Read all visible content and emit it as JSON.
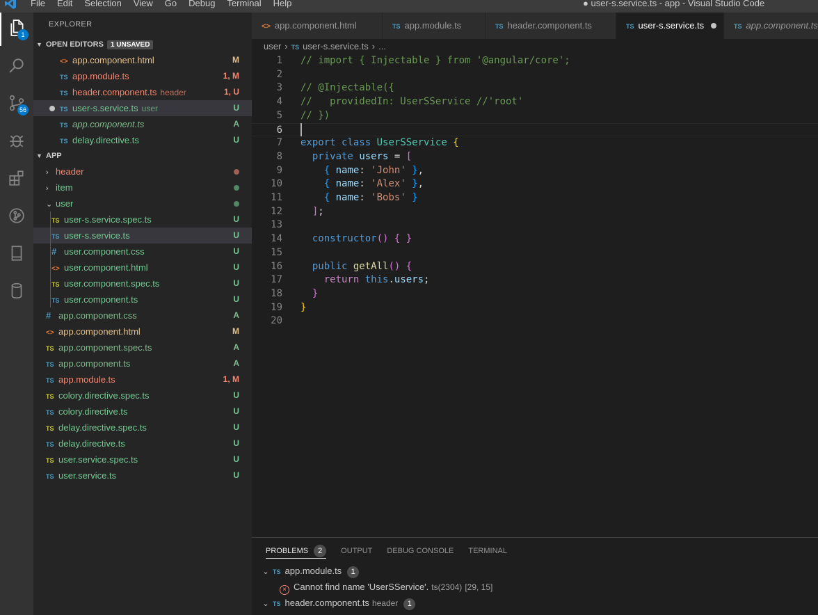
{
  "window": {
    "menu": [
      "File",
      "Edit",
      "Selection",
      "View",
      "Go",
      "Debug",
      "Terminal",
      "Help"
    ],
    "title": "● user-s.service.ts - app - Visual Studio Code"
  },
  "activity": {
    "explorer_badge": "1",
    "scm_badge": "56"
  },
  "sidebar": {
    "title": "EXPLORER",
    "open_editors": {
      "header": "OPEN EDITORS",
      "badge": "1 UNSAVED",
      "items": [
        {
          "icon": "html",
          "label": "app.component.html",
          "desc": "",
          "status": "M",
          "color": "#e2c08d",
          "italic": false,
          "dirty": false
        },
        {
          "icon": "ts",
          "label": "app.module.ts",
          "desc": "",
          "status": "1, M",
          "color": "#f48771",
          "italic": false,
          "dirty": false
        },
        {
          "icon": "ts",
          "label": "header.component.ts",
          "desc": "header",
          "status": "1, U",
          "color": "#f48771",
          "italic": false,
          "dirty": false
        },
        {
          "icon": "ts",
          "label": "user-s.service.ts",
          "desc": "user",
          "status": "U",
          "color": "#73c991",
          "italic": false,
          "dirty": true
        },
        {
          "icon": "ts",
          "label": "app.component.ts",
          "desc": "",
          "status": "A",
          "color": "#81b88b",
          "italic": true,
          "dirty": false
        },
        {
          "icon": "ts",
          "label": "delay.directive.ts",
          "desc": "",
          "status": "U",
          "color": "#73c991",
          "italic": false,
          "dirty": false
        }
      ]
    },
    "app_section": {
      "header": "APP",
      "items": [
        {
          "type": "folder",
          "icon": "chev-right",
          "label": "header",
          "status": "dot",
          "color": "#f48771",
          "depth": 0
        },
        {
          "type": "folder",
          "icon": "chev-right",
          "label": "item",
          "status": "dot",
          "color": "#73c991",
          "depth": 0
        },
        {
          "type": "folder",
          "icon": "chev-down",
          "label": "user",
          "status": "dot",
          "color": "#73c991",
          "depth": 0
        },
        {
          "type": "file",
          "icon": "tsy",
          "label": "user-s.service.spec.ts",
          "status": "U",
          "color": "#73c991",
          "depth": 1
        },
        {
          "type": "file",
          "icon": "ts",
          "label": "user-s.service.ts",
          "status": "U",
          "color": "#73c991",
          "depth": 1
        },
        {
          "type": "file",
          "icon": "css",
          "label": "user.component.css",
          "status": "U",
          "color": "#73c991",
          "depth": 1
        },
        {
          "type": "file",
          "icon": "html",
          "label": "user.component.html",
          "status": "U",
          "color": "#73c991",
          "depth": 1
        },
        {
          "type": "file",
          "icon": "tsy",
          "label": "user.component.spec.ts",
          "status": "U",
          "color": "#73c991",
          "depth": 1
        },
        {
          "type": "file",
          "icon": "ts",
          "label": "user.component.ts",
          "status": "U",
          "color": "#73c991",
          "depth": 1
        },
        {
          "type": "file",
          "icon": "css",
          "label": "app.component.css",
          "status": "A",
          "color": "#81b88b",
          "depth": 0
        },
        {
          "type": "file",
          "icon": "html",
          "label": "app.component.html",
          "status": "M",
          "color": "#e2c08d",
          "depth": 0
        },
        {
          "type": "file",
          "icon": "tsy",
          "label": "app.component.spec.ts",
          "status": "A",
          "color": "#81b88b",
          "depth": 0
        },
        {
          "type": "file",
          "icon": "ts",
          "label": "app.component.ts",
          "status": "A",
          "color": "#81b88b",
          "depth": 0
        },
        {
          "type": "file",
          "icon": "ts",
          "label": "app.module.ts",
          "status": "1, M",
          "color": "#f48771",
          "depth": 0
        },
        {
          "type": "file",
          "icon": "tsy",
          "label": "colory.directive.spec.ts",
          "status": "U",
          "color": "#73c991",
          "depth": 0
        },
        {
          "type": "file",
          "icon": "ts",
          "label": "colory.directive.ts",
          "status": "U",
          "color": "#73c991",
          "depth": 0
        },
        {
          "type": "file",
          "icon": "tsy",
          "label": "delay.directive.spec.ts",
          "status": "U",
          "color": "#73c991",
          "depth": 0
        },
        {
          "type": "file",
          "icon": "ts",
          "label": "delay.directive.ts",
          "status": "U",
          "color": "#73c991",
          "depth": 0
        },
        {
          "type": "file",
          "icon": "tsy",
          "label": "user.service.spec.ts",
          "status": "U",
          "color": "#73c991",
          "depth": 0
        },
        {
          "type": "file",
          "icon": "ts",
          "label": "user.service.ts",
          "status": "U",
          "color": "#73c991",
          "depth": 0
        }
      ]
    }
  },
  "tabs": [
    {
      "icon": "html",
      "label": "app.component.html",
      "active": false,
      "dirty": false,
      "preview": false
    },
    {
      "icon": "ts",
      "label": "app.module.ts",
      "active": false,
      "dirty": false,
      "preview": false
    },
    {
      "icon": "ts",
      "label": "header.component.ts",
      "active": false,
      "dirty": false,
      "preview": false
    },
    {
      "icon": "ts",
      "label": "user-s.service.ts",
      "active": true,
      "dirty": true,
      "preview": false
    },
    {
      "icon": "ts",
      "label": "app.component.ts",
      "active": false,
      "dirty": false,
      "preview": true
    }
  ],
  "breadcrumb": {
    "folder": "user",
    "file": "user-s.service.ts",
    "symbol": "..."
  },
  "editor": {
    "lines": [
      [
        [
          "c-com",
          "// import { Injectable } from '@angular/core';"
        ]
      ],
      [],
      [
        [
          "c-com",
          "// @Injectable({"
        ]
      ],
      [
        [
          "c-com",
          "//   providedIn: UserSService //'root'"
        ]
      ],
      [
        [
          "c-com",
          "// })"
        ]
      ],
      [],
      [
        [
          "c-kw",
          "export"
        ],
        [
          "c-p",
          " "
        ],
        [
          "c-kw",
          "class"
        ],
        [
          "c-p",
          " "
        ],
        [
          "c-cls",
          "UserSService"
        ],
        [
          "c-p",
          " "
        ],
        [
          "c-b1",
          "{"
        ]
      ],
      [
        [
          "c-p",
          "  "
        ],
        [
          "c-kw",
          "private"
        ],
        [
          "c-p",
          " "
        ],
        [
          "c-prop",
          "users"
        ],
        [
          "c-p",
          " = "
        ],
        [
          "c-b2",
          "["
        ]
      ],
      [
        [
          "c-p",
          "    "
        ],
        [
          "c-b3",
          "{"
        ],
        [
          "c-p",
          " "
        ],
        [
          "c-prop",
          "name"
        ],
        [
          "c-p",
          ": "
        ],
        [
          "c-str",
          "'John'"
        ],
        [
          "c-p",
          " "
        ],
        [
          "c-b3",
          "}"
        ],
        [
          "c-p",
          ","
        ]
      ],
      [
        [
          "c-p",
          "    "
        ],
        [
          "c-b3",
          "{"
        ],
        [
          "c-p",
          " "
        ],
        [
          "c-prop",
          "name"
        ],
        [
          "c-p",
          ": "
        ],
        [
          "c-str",
          "'Alex'"
        ],
        [
          "c-p",
          " "
        ],
        [
          "c-b3",
          "}"
        ],
        [
          "c-p",
          ","
        ]
      ],
      [
        [
          "c-p",
          "    "
        ],
        [
          "c-b3",
          "{"
        ],
        [
          "c-p",
          " "
        ],
        [
          "c-prop",
          "name"
        ],
        [
          "c-p",
          ": "
        ],
        [
          "c-str",
          "'Bobs'"
        ],
        [
          "c-p",
          " "
        ],
        [
          "c-b3",
          "}"
        ]
      ],
      [
        [
          "c-p",
          "  "
        ],
        [
          "c-b2",
          "]"
        ],
        [
          "c-p",
          ";"
        ]
      ],
      [],
      [
        [
          "c-p",
          "  "
        ],
        [
          "c-kw",
          "constructor"
        ],
        [
          "c-b2",
          "()"
        ],
        [
          "c-p",
          " "
        ],
        [
          "c-b2",
          "{"
        ],
        [
          "c-p",
          " "
        ],
        [
          "c-b2",
          "}"
        ]
      ],
      [],
      [
        [
          "c-p",
          "  "
        ],
        [
          "c-kw",
          "public"
        ],
        [
          "c-p",
          " "
        ],
        [
          "c-fn",
          "getAll"
        ],
        [
          "c-b2",
          "()"
        ],
        [
          "c-p",
          " "
        ],
        [
          "c-b2",
          "{"
        ]
      ],
      [
        [
          "c-p",
          "    "
        ],
        [
          "c-kw2",
          "return"
        ],
        [
          "c-p",
          " "
        ],
        [
          "c-kw",
          "this"
        ],
        [
          "c-p",
          "."
        ],
        [
          "c-prop",
          "users"
        ],
        [
          "c-p",
          ";"
        ]
      ],
      [
        [
          "c-p",
          "  "
        ],
        [
          "c-b2",
          "}"
        ]
      ],
      [
        [
          "c-b1",
          "}"
        ]
      ],
      []
    ]
  },
  "panel": {
    "tabs": [
      {
        "label": "PROBLEMS",
        "count": "2",
        "active": true
      },
      {
        "label": "OUTPUT",
        "count": "",
        "active": false
      },
      {
        "label": "DEBUG CONSOLE",
        "count": "",
        "active": false
      },
      {
        "label": "TERMINAL",
        "count": "",
        "active": false
      }
    ],
    "problems": [
      {
        "file": "app.module.ts",
        "desc": "",
        "count": "1",
        "message": "Cannot find name 'UserSService'.",
        "code": "ts(2304)",
        "location": "[29, 15]"
      },
      {
        "file": "header.component.ts",
        "desc": "header",
        "count": "1"
      }
    ]
  }
}
